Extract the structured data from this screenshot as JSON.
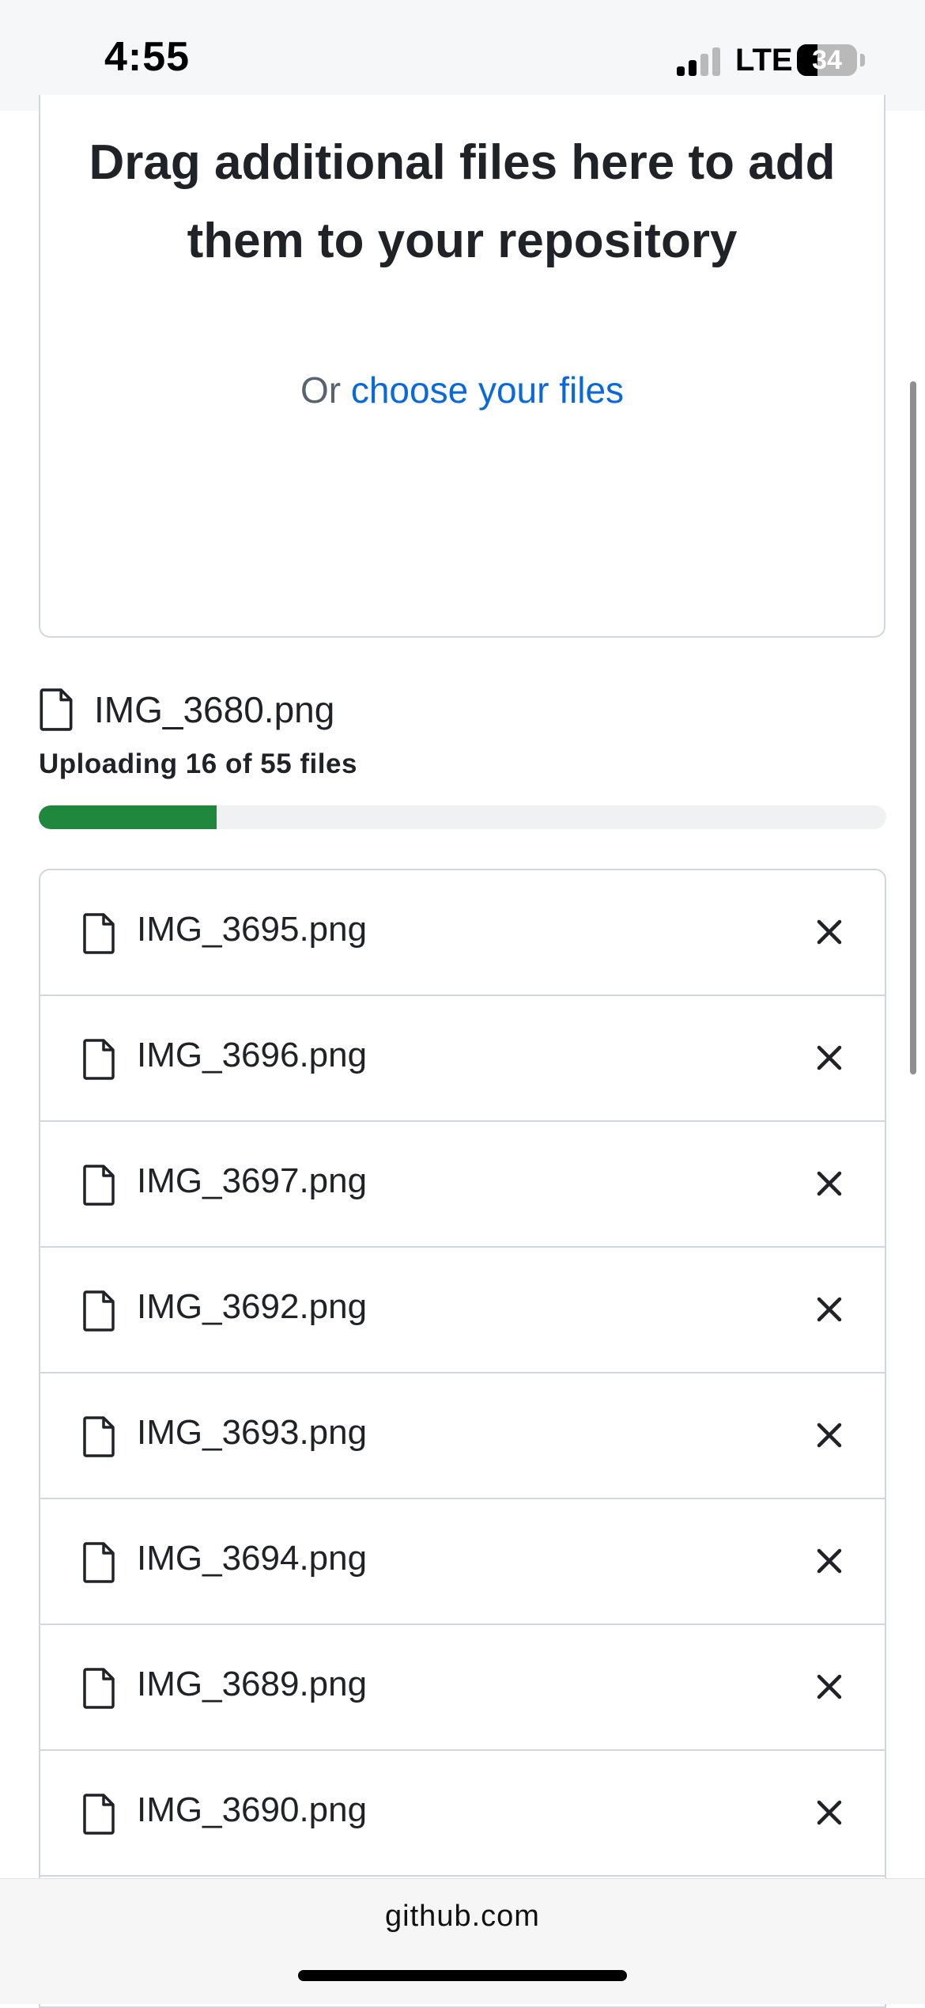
{
  "status_bar": {
    "time": "4:55",
    "network": "LTE",
    "battery_level": "34",
    "battery_fraction": 0.34,
    "signal_bars_active": 2,
    "signal_bars_total": 4
  },
  "dropzone": {
    "title": "Drag additional files here to add them to your repository",
    "or_text": "Or",
    "choose_link": "choose your files"
  },
  "upload": {
    "current_file": "IMG_3680.png",
    "status_text": "Uploading 16 of 55 files",
    "progress_fraction": 0.21
  },
  "file_list": [
    {
      "name": "IMG_3695.png"
    },
    {
      "name": "IMG_3696.png"
    },
    {
      "name": "IMG_3697.png"
    },
    {
      "name": "IMG_3692.png"
    },
    {
      "name": "IMG_3693.png"
    },
    {
      "name": "IMG_3694.png"
    },
    {
      "name": "IMG_3689.png"
    },
    {
      "name": "IMG_3690.png"
    },
    {
      "name": ""
    }
  ],
  "browser": {
    "url": "github.com"
  },
  "colors": {
    "progress_fill": "#1f883d",
    "link": "#0969da"
  }
}
